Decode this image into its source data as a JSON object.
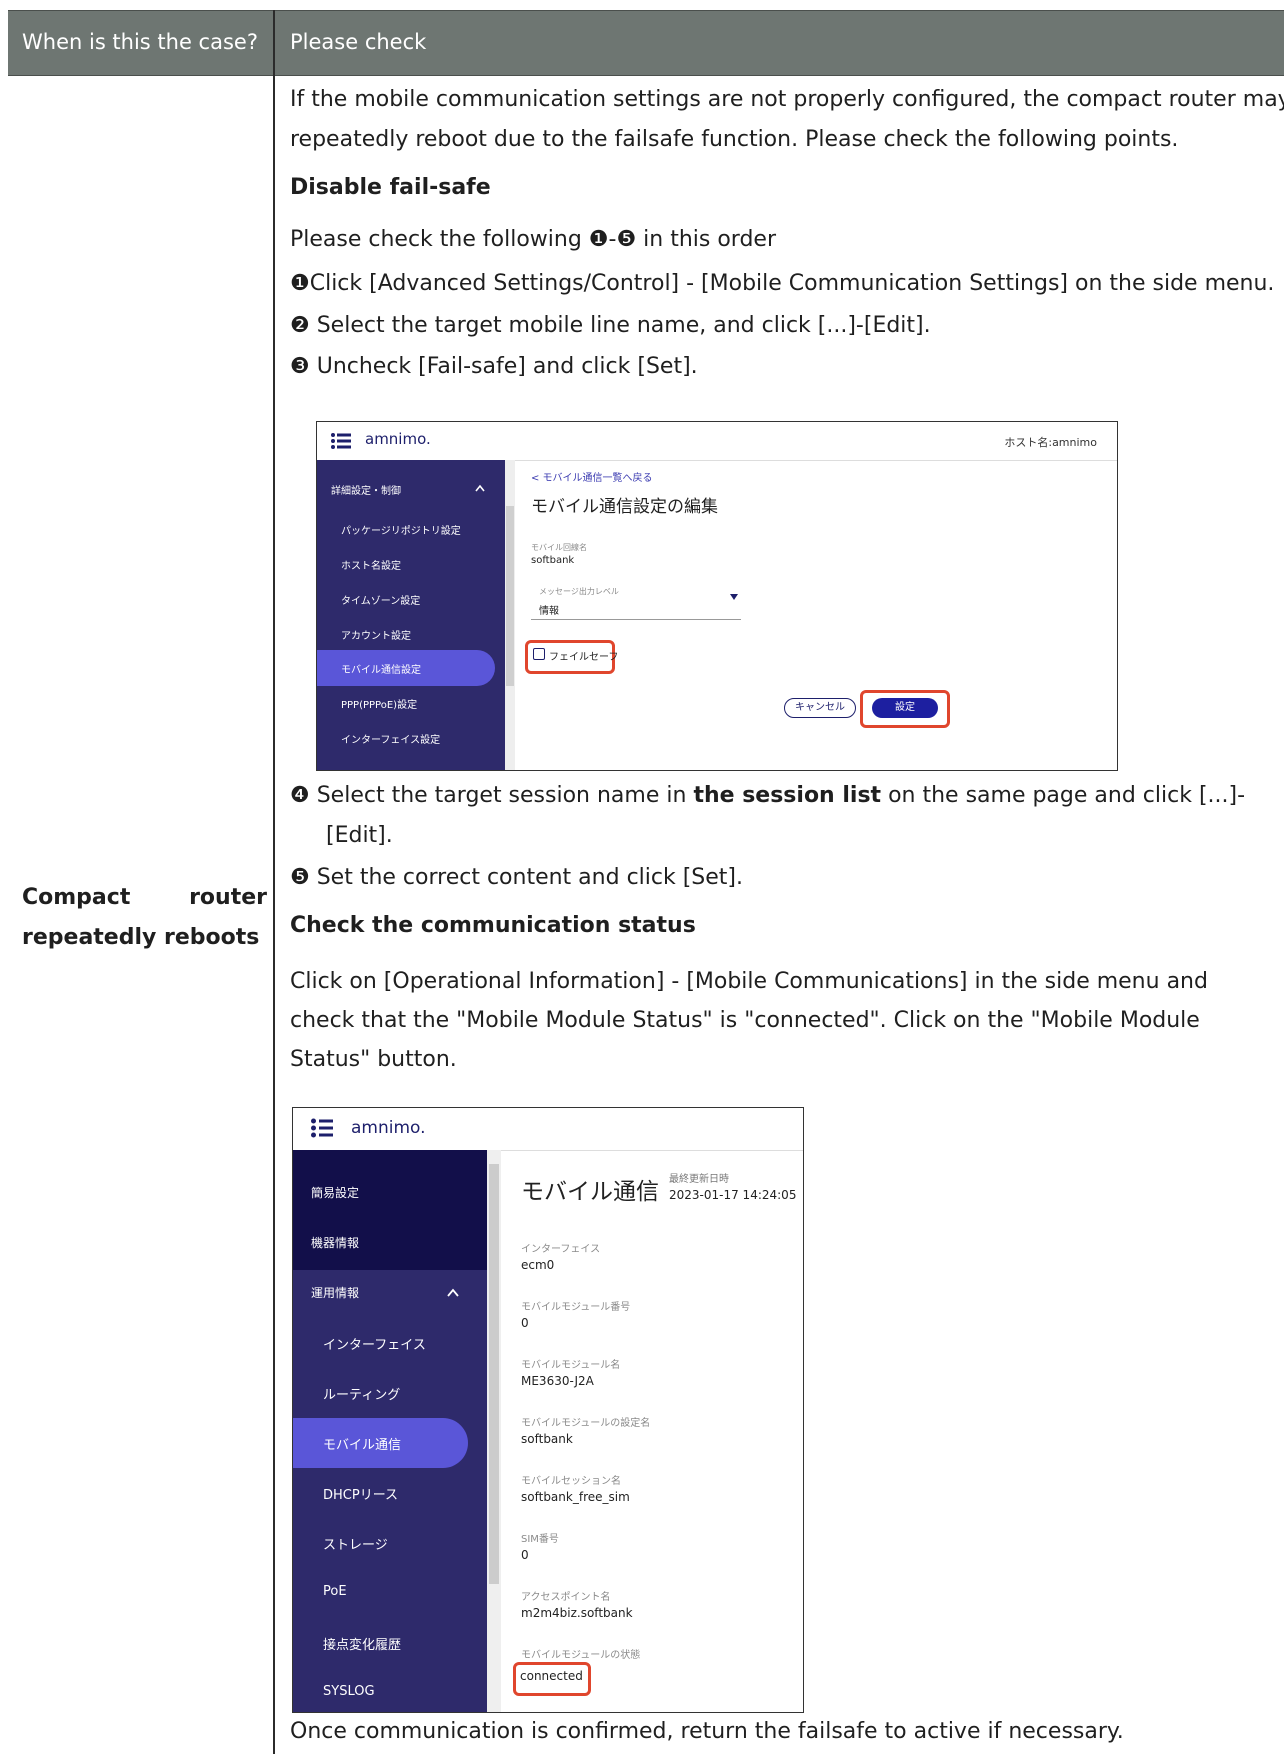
{
  "header": {
    "col1": "When is this the case?",
    "col2": "Please check"
  },
  "left": {
    "word1": "Compact",
    "word2": "router",
    "line2": "repeatedly reboots"
  },
  "intro": {
    "line1": "If the mobile communication settings are not properly configured, the compact router may",
    "line2": "repeatedly reboot due to the failsafe function. Please check the following points."
  },
  "section1": {
    "title": "Disable fail-safe",
    "order": "Please check the following ❶-❺ in this order",
    "step1": "❶Click [Advanced Settings/Control] - [Mobile Communication Settings] on the side menu.",
    "step2": "❷ Select the target mobile line name, and click [...]-[Edit].",
    "step3": "❸ Uncheck [Fail-safe] and click [Set].",
    "step4_pre": "❹ Select the target session name in ",
    "step4_bold": "the session list",
    "step4_post": " on the same page and click [...]-",
    "step4_line2": "[Edit].",
    "step5": "❺ Set the correct content and click [Set]."
  },
  "shot1": {
    "logo": "amnimo.",
    "hostname": "ホスト名:amnimo",
    "sidebar": {
      "section": "詳細設定・制御",
      "items": [
        "パッケージリポジトリ設定",
        "ホスト名設定",
        "タイムゾーン設定",
        "アカウント設定",
        "モバイル通信設定",
        "PPP(PPPoE)設定",
        "インターフェイス設定"
      ]
    },
    "back_link": "< モバイル通信一覧へ戻る",
    "title": "モバイル通信設定の編集",
    "line_label": "モバイル回線名",
    "line_value": "softbank",
    "level_label": "メッセージ出力レベル",
    "level_value": "情報",
    "failsafe_label": "フェイルセーフ",
    "cancel_label": "キャンセル",
    "set_label": "設定"
  },
  "section2": {
    "title": "Check the communication status",
    "line1": "Click on [Operational Information] - [Mobile Communications] in the side menu and",
    "line2": "check that the \"Mobile Module Status\" is \"connected\". Click on the \"Mobile Module",
    "line3": "Status\" button."
  },
  "shot2": {
    "logo": "amnimo.",
    "sidebar": {
      "top_items": [
        "簡易設定",
        "機器情報",
        "運用情報"
      ],
      "sub_items": [
        "インターフェイス",
        "ルーティング",
        "モバイル通信",
        "DHCPリース",
        "ストレージ",
        "PoE",
        "接点変化履歴",
        "SYSLOG"
      ]
    },
    "title": "モバイル通信",
    "updated_label": "最終更新日時",
    "updated_value": "2023-01-17 14:24:05",
    "fields": [
      {
        "label": "インターフェイス",
        "value": "ecm0"
      },
      {
        "label": "モバイルモジュール番号",
        "value": "0"
      },
      {
        "label": "モバイルモジュール名",
        "value": "ME3630-J2A"
      },
      {
        "label": "モバイルモジュールの設定名",
        "value": "softbank"
      },
      {
        "label": "モバイルセッション名",
        "value": "softbank_free_sim"
      },
      {
        "label": "SIM番号",
        "value": "0"
      },
      {
        "label": "アクセスポイント名",
        "value": "m2m4biz.softbank"
      },
      {
        "label": "モバイルモジュールの状態",
        "value": "connected"
      }
    ]
  },
  "footer_text": "Once communication is confirmed, return the failsafe to active if necessary."
}
